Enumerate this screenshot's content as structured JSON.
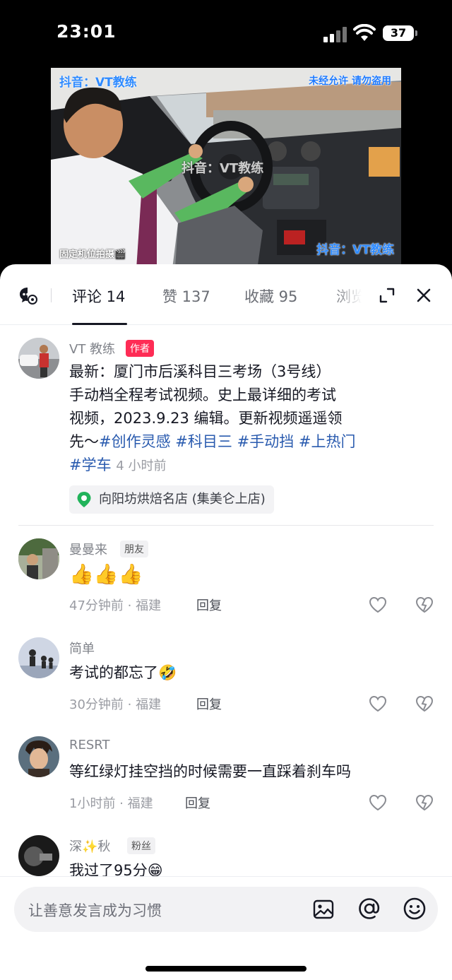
{
  "status_bar": {
    "time": "23:01",
    "battery": "37"
  },
  "video": {
    "watermark_top_left": "抖音：VT教练",
    "watermark_top_right": "未经允许 请勿盗用",
    "watermark_center": "抖音：VT教练",
    "watermark_bottom_right": "抖音：VT教练",
    "watermark_bottom_left": "固定机位拍摄🎬"
  },
  "tabs": [
    {
      "label": "评论 14",
      "active": true
    },
    {
      "label": "赞 137"
    },
    {
      "label": "收藏 95"
    },
    {
      "label": "浏览"
    }
  ],
  "author_comment": {
    "name": "VT 教练",
    "tag": "作者",
    "lines": [
      "最新：厦门市后溪科目三考场（3号线）",
      "手动档全程考试视频。史上最详细的考试",
      "视频，2023.9.23 编辑。更新视频遥遥领"
    ],
    "line4_prefix": "先～",
    "hashtags": [
      "#创作灵感",
      "#科目三",
      "#手动挡",
      "#上热门",
      "#学车"
    ],
    "time": "4 小时前",
    "location": "向阳坊烘焙名店 (集美仑上店)"
  },
  "comments": [
    {
      "name": "曼曼来",
      "tag": "朋友",
      "text": "",
      "emoji": "👍👍👍",
      "meta": "47分钟前 · 福建",
      "reply": "回复"
    },
    {
      "name": "简单",
      "text": "考试的都忘了",
      "emoji": "🤣",
      "meta": "30分钟前 · 福建",
      "reply": "回复"
    },
    {
      "name": "RESRT",
      "text": "等红绿灯挂空挡的时候需要一直踩着刹车吗",
      "meta": "1小时前 · 福建",
      "reply": "回复"
    },
    {
      "name": "深✨秋",
      "tag": "粉丝",
      "text": "我过了95分",
      "emoji": "😁"
    }
  ],
  "input": {
    "placeholder": "让善意发言成为习惯"
  },
  "colors": {
    "accent_red": "#fe2c55",
    "hashtag_blue": "#2a5baf"
  }
}
